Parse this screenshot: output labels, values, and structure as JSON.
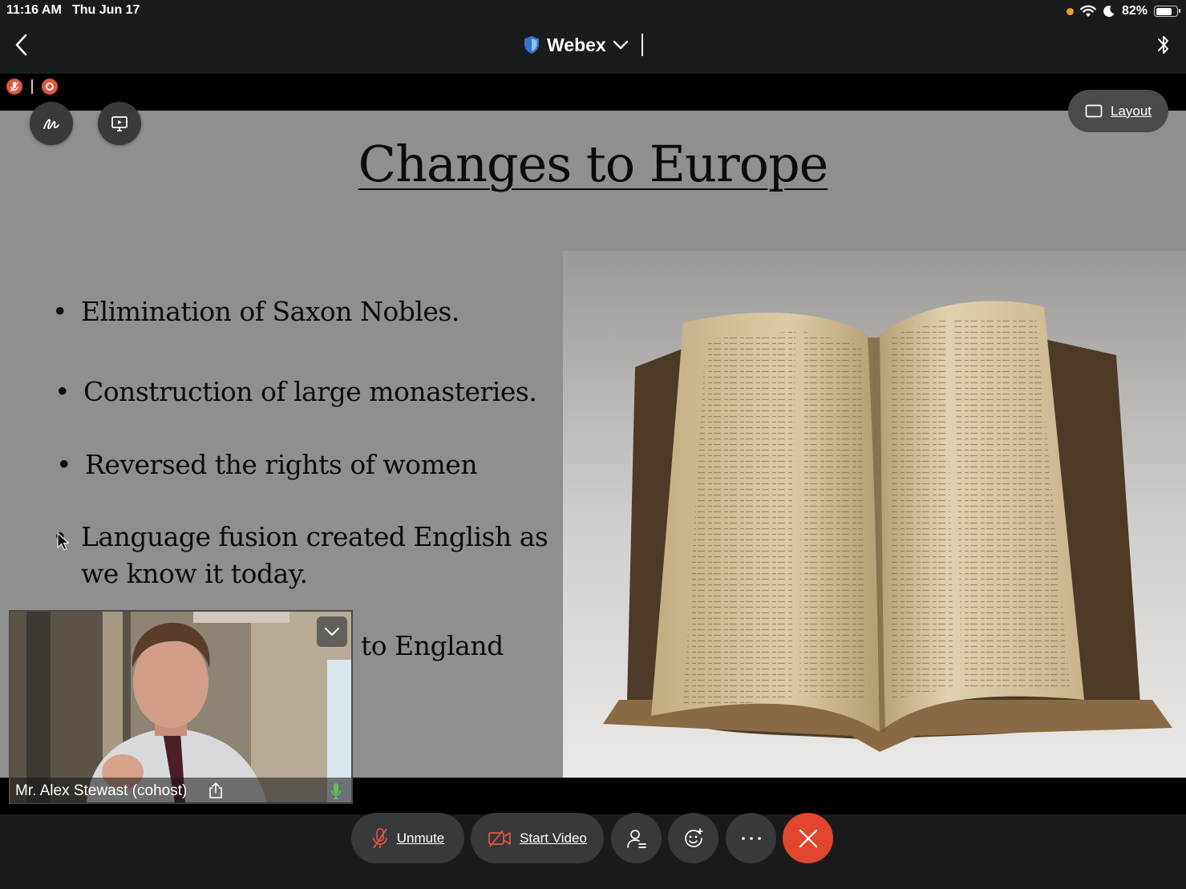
{
  "status_bar": {
    "time": "11:16 AM",
    "date": "Thu Jun 17",
    "battery_percent_label": "82%",
    "battery_level": 0.82,
    "icons": [
      "orange-dot",
      "wifi-icon",
      "moon-icon",
      "battery-icon"
    ]
  },
  "header": {
    "title": "Webex",
    "icons": [
      "back-chevron-icon",
      "shield-icon",
      "chevron-down-icon",
      "bluetooth-icon"
    ]
  },
  "indicators": {
    "icons": [
      "muted-mic-icon",
      "recording-icon"
    ]
  },
  "slide": {
    "title": "Changes to Europe",
    "bullets": [
      {
        "text": "Elimination of Saxon Nobles."
      },
      {
        "text": "Construction of large monasteries."
      },
      {
        "text": "Reversed the rights of women"
      },
      {
        "line1": "Language fusion created English as",
        "line2": "we know it today."
      },
      {
        "text": "to England"
      }
    ],
    "image": "open-manuscript-book-photo"
  },
  "layout_button": {
    "label": "Layout",
    "icon": "layout-icon"
  },
  "self_view": {
    "name": "Mr. Alex Stewast (cohost)",
    "icons": [
      "share-icon",
      "mic-active-icon",
      "chevron-down-icon"
    ]
  },
  "controls": {
    "unmute_label": "Unmute",
    "start_video_label": "Start Video",
    "icons": [
      "mic-off-icon",
      "video-off-icon",
      "participants-icon",
      "reactions-icon",
      "more-icon",
      "end-call-icon"
    ]
  },
  "colors": {
    "end_call": "#e2462d",
    "record_badge": "#e2553f",
    "mic_active": "#5fc25a",
    "shield": "#3c8ff0",
    "control_bg": "#38393b"
  }
}
